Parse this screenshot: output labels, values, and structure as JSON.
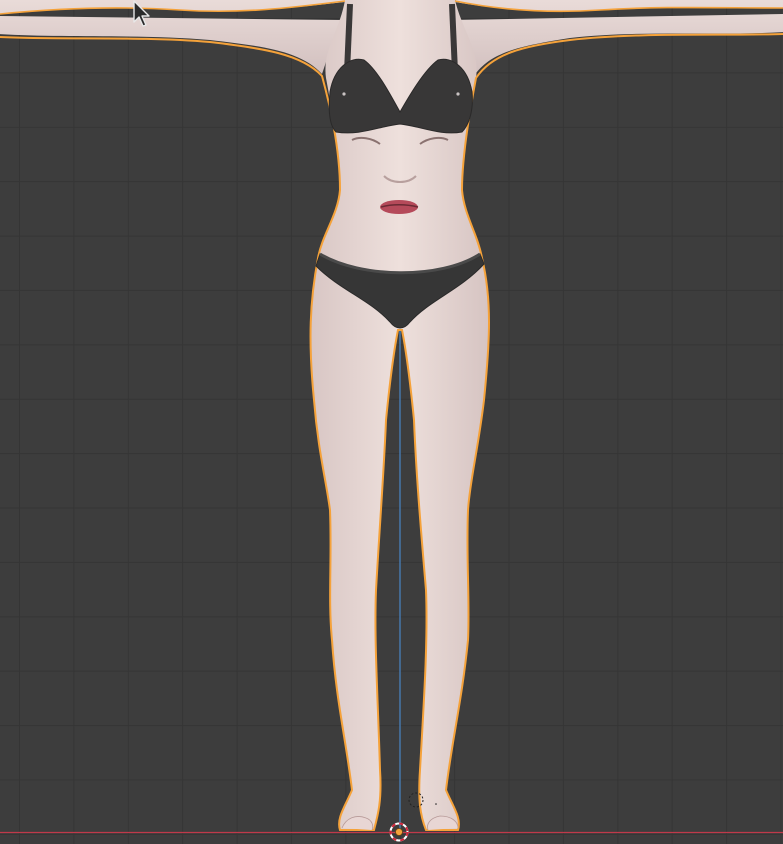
{
  "viewport": {
    "view": "front-orthographic",
    "background_color": "#3d3d3d",
    "grid_color": "#353535",
    "selection_outline_color": "#f5a23a",
    "x_axis_color": "#c0394a",
    "z_axis_color": "#4a87c8",
    "selected_object": "female-body-mesh",
    "cursor": "pointer-arrow-icon"
  }
}
